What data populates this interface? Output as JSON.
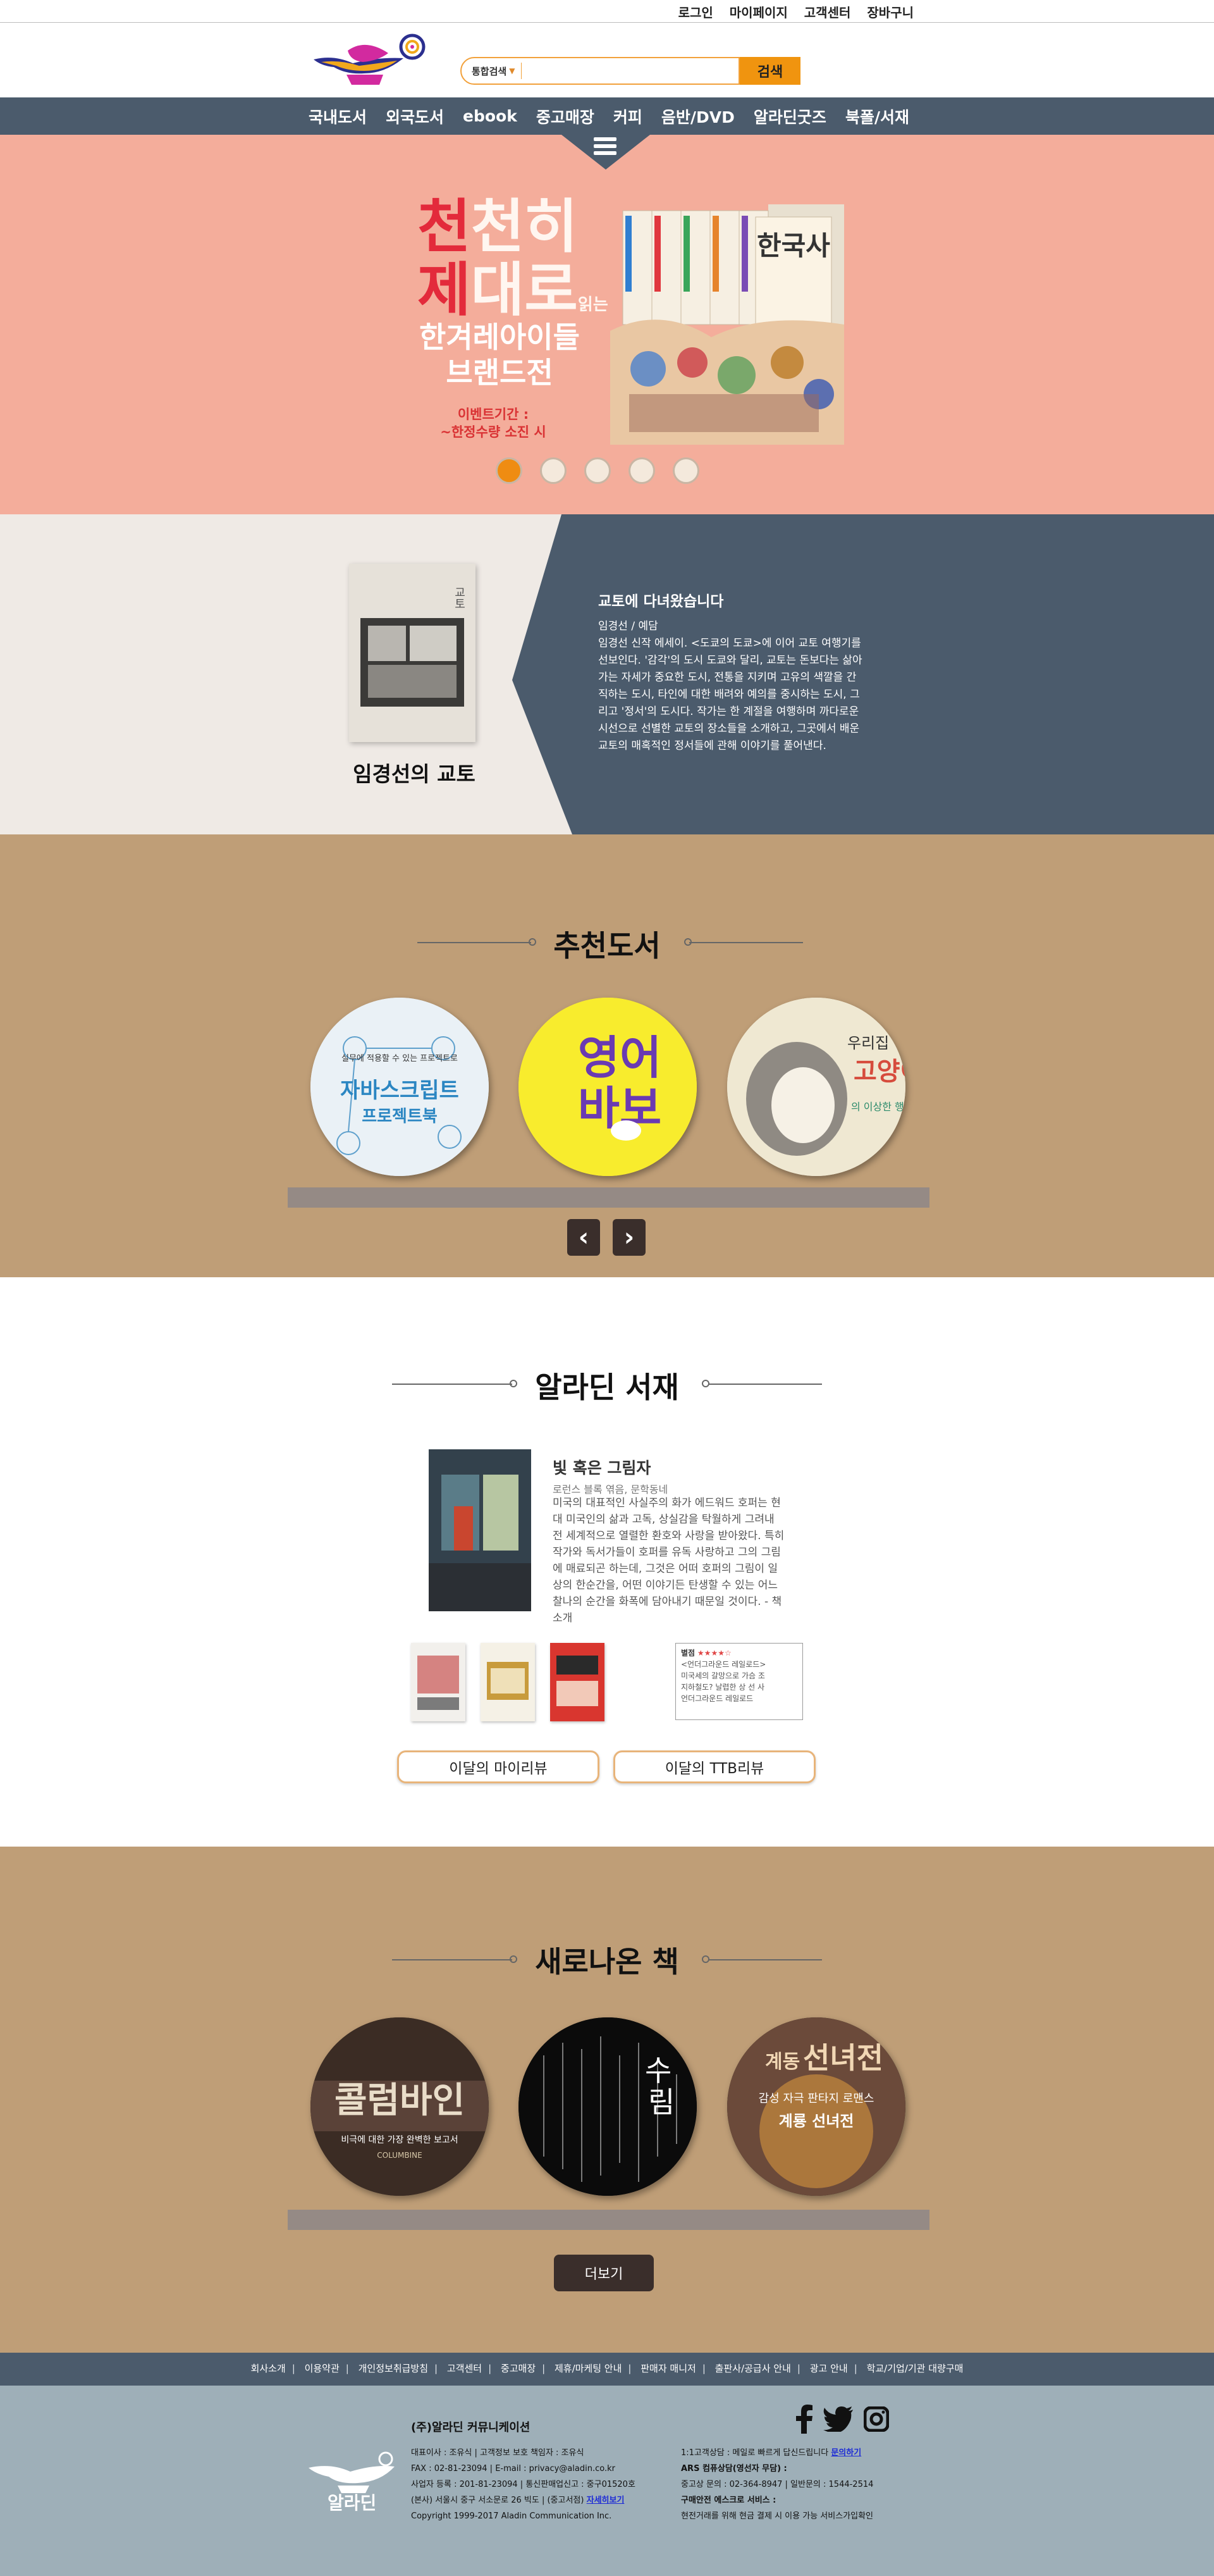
{
  "topbar": {
    "links": [
      "로그인",
      "마이페이지",
      "고객센터",
      "장바구니"
    ]
  },
  "search": {
    "category": "통합검색",
    "placeholder": "",
    "button": "검색"
  },
  "nav": {
    "items": [
      "국내도서",
      "외국도서",
      "ebook",
      "중고매장",
      "커피",
      "음반/DVD",
      "알라딘굿즈",
      "북폴/서재"
    ]
  },
  "hero": {
    "title_line1": [
      "천",
      "천히"
    ],
    "title_line2": [
      "제",
      "대로",
      "읽는"
    ],
    "brand": [
      "한겨레아이들",
      "브랜드전"
    ],
    "period": [
      "이벤트기간 :",
      "~한정수량 소진 시"
    ],
    "book_label": "한국사",
    "slides": 5,
    "active_slide": 1
  },
  "featured": {
    "cover_title": "교토",
    "book_title": "임경선의 교토",
    "heading": "교토에 다녀왔습니다",
    "description": "임경선 / 예담\n임경선 신작 에세이. <도쿄의 도쿄>에 이어 교토 여행기를 선보인다. '감각'의 도시 도쿄와 달리, 교토는 돈보다는 삶아가는 자세가 중요한 도시, 전통을 지키며 고유의 색깔을 간직하는 도시, 타인에 대한 배려와 예의를 중시하는 도시, 그리고 '정서'의 도시다. 작가는 한 계절을 여행하며 까다로운 시선으로 선별한 교토의 장소들을 소개하고, 그곳에서 배운 교토의 매혹적인 정서들에 관해 이야기를 풀어낸다."
  },
  "recommend": {
    "title": "추천도서",
    "books": [
      {
        "line1": "실무에 적용할 수 있는 프로젝트로",
        "line2": "자바스크립트",
        "line3": "프로젝트북"
      },
      {
        "line1": "영어",
        "line2": "바보"
      },
      {
        "line1": "우리집",
        "line2": "고양이",
        "line3": "의 이상한 행동"
      }
    ]
  },
  "shelf": {
    "title": "알라딘 서재",
    "book_title": "빛 혹은 그림자",
    "book_sub": "로런스 블록 엮음, 문학동네",
    "book_desc": "미국의 대표적인 사실주의 화가 에드워드 호퍼는 현대 미국인의 삶과 고독, 상실감을 탁월하게 그려내 전 세계적으로 열렬한 환호와 사랑을 받아왔다. 특히 작가와 독서가들이 호퍼를 유독 사랑하고 그의 그림에 매료되곤 하는데, 그것은 어떠 호퍼의 그림이 일상의 한순간을, 어떤 이야기든 탄생할 수 있는 어느 찰나의 순간을 화폭에 담아내기 때문일 것이다. - 책소개",
    "review_title": "별점",
    "review_lines": [
      "<언더그라운드 레일로드>",
      "미국세의 갈망으로 가슴 조",
      "지하철도? 날렵한 상 선 사",
      "언더그라운드 레일로드"
    ],
    "buttons": [
      "이달의 마이리뷰",
      "이달의 TTB리뷰"
    ]
  },
  "newbooks": {
    "title": "새로나온 책",
    "books": [
      {
        "line1": "콜럼바인",
        "line2": "비극에 대한 가장 완벽한 보고서",
        "line3": "COLUMBINE"
      },
      {
        "line1": "수",
        "line2": "림"
      },
      {
        "line1": "계동",
        "line2": "선녀전",
        "line3": "감성 자극 판타지 로맨스",
        "line4": "계룡 선녀전"
      }
    ],
    "more": "더보기"
  },
  "footer_links": [
    "회사소개",
    "이용약관",
    "개인정보취급방침",
    "고객센터",
    "중고매장",
    "제휴/마케팅 안내",
    "판매자 매니저",
    "출판사/공급사 안내",
    "광고 안내",
    "학교/기업/기관 대량구매"
  ],
  "footer": {
    "company": "(주)알라딘 커뮤니케이션",
    "brand": "알라딘",
    "info": [
      "대표이사 : 조유식 | 고객정보 보호 책임자 : 조유식",
      "FAX : 02-81-23094 | E-mail : privacy@aladin.co.kr",
      "사업자 등록 : 201-81-23094 | 통신판매업신고 : 중구01520호",
      "(본사) 서울시 중구 서소문로 26 빅도 | (중고서점)",
      "Copyright 1999-2017 Aladin Communication Inc."
    ],
    "info_link": "자세히보기",
    "cs": [
      "1:1고객상담 : 메일로 빠르게 답신드립니다",
      "ARS 컴퓨상담(영선자 무담) :",
      "중고상 문의 : 02-364-8947 | 일반문의 : 1544-2514",
      "구매안전 에스크로 서비스 :",
      "현전거래를 위해 현금 결제 시 이용 가능 서비스가입확인"
    ],
    "cs_link": "문의하기",
    "social": [
      "facebook-icon",
      "twitter-icon",
      "instagram-icon"
    ]
  },
  "colors": {
    "nav": "#4b5b6c",
    "hero": "#f4ad9b",
    "accent_orange": "#f0940f",
    "brown": "#bf9e77",
    "footer": "#9eafb8",
    "dark_button": "#3a2e2b"
  }
}
